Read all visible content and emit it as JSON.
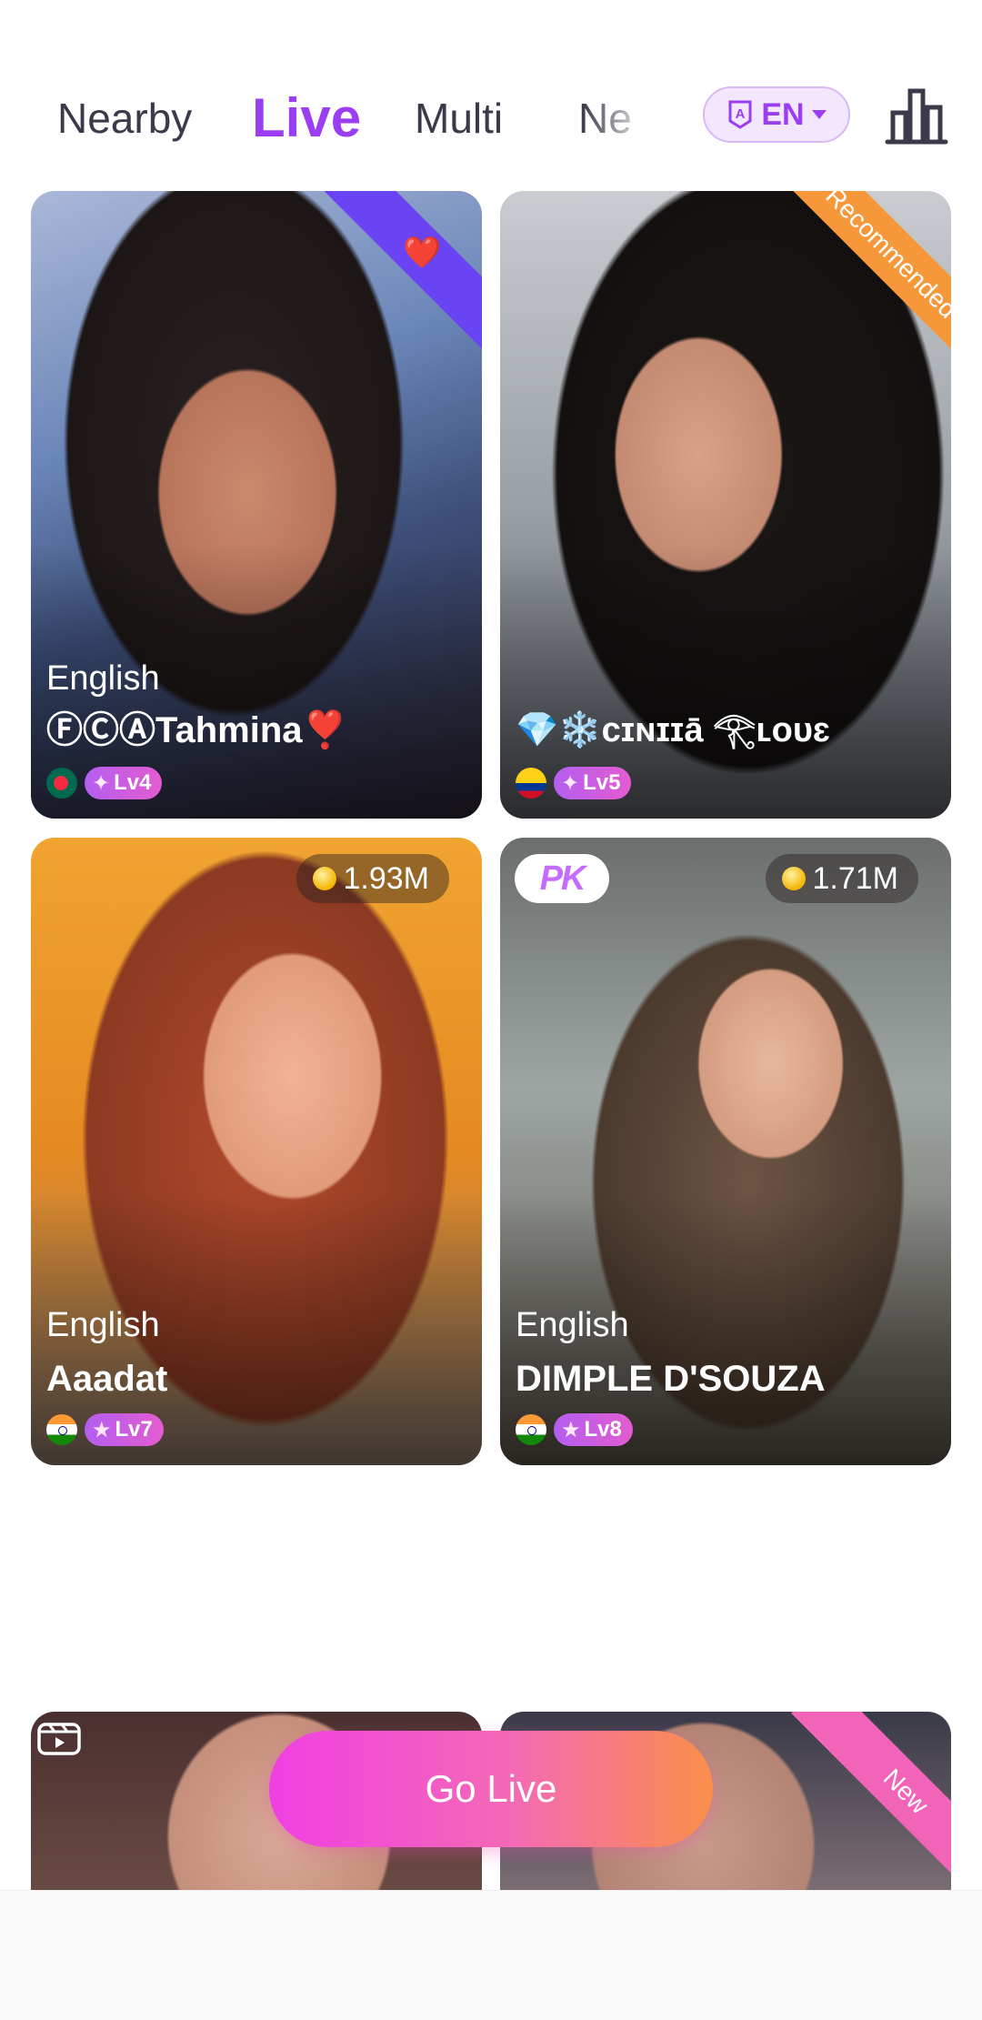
{
  "tabs": [
    {
      "label": "Nearby",
      "active": false
    },
    {
      "label": "Live",
      "active": true
    },
    {
      "label": "Multi",
      "active": false
    },
    {
      "label": "Ne",
      "active": false
    }
  ],
  "language_button": {
    "label": "EN",
    "icon": "translate-badge-icon"
  },
  "rank_icon": "bar-chart-icon",
  "colors": {
    "accent": "#9b3df0",
    "go_live_start": "#f03fe3",
    "go_live_end": "#fa8f4a"
  },
  "cards": [
    {
      "language": "English",
      "name": "ⒻⒸⒶTahmina❣️",
      "flag": "Bangladesh",
      "level": "Lv4",
      "ribbon": "heart-wings-icon"
    },
    {
      "language": "English",
      "name": "💎❄️cɪɴɪɪā 𓂀ʟoᴜɛ",
      "flag": "Colombia",
      "level": "Lv5",
      "ribbon": "Recommended"
    },
    {
      "language": "English",
      "name": "Aaadat",
      "flag": "India",
      "level": "Lv7",
      "coins": "1.93M"
    },
    {
      "language": "English",
      "name": "DIMPLE D'SOUZA",
      "flag": "India",
      "level": "Lv8",
      "coins": "1.71M",
      "badge": "PK"
    },
    {
      "overlay_icon": "video-reel-icon"
    },
    {
      "ribbon": "New"
    }
  ],
  "go_live": {
    "label": "Go Live"
  }
}
